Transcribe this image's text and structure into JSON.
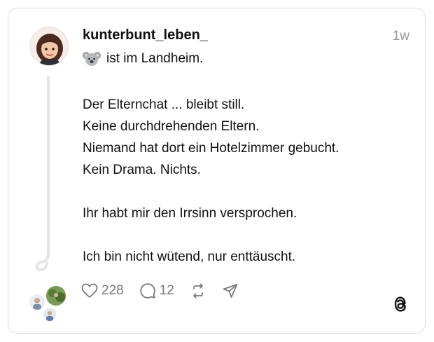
{
  "post": {
    "username": "kunterbunt_leben_",
    "timestamp": "1w",
    "status_text": "ist im Landheim.",
    "status_icon": "koala-emoji",
    "lines": [
      "Der Elternchat ... bleibt still.",
      "Keine durchdrehenden Eltern.",
      "Niemand hat dort ein Hotelzimmer gebucht.",
      "Kein Drama. Nichts.",
      "",
      "Ihr habt mir den Irrsinn versprochen.",
      "",
      "Ich bin nicht wütend, nur enttäuscht."
    ]
  },
  "actions": {
    "like_count": "228",
    "reply_count": "12",
    "icons": [
      "heart-icon",
      "comment-icon",
      "repost-icon",
      "share-icon"
    ]
  },
  "brand": {
    "logo": "threads-logo"
  },
  "colors": {
    "text": "#101010",
    "muted": "#999999",
    "border": "#dcdcdc"
  }
}
